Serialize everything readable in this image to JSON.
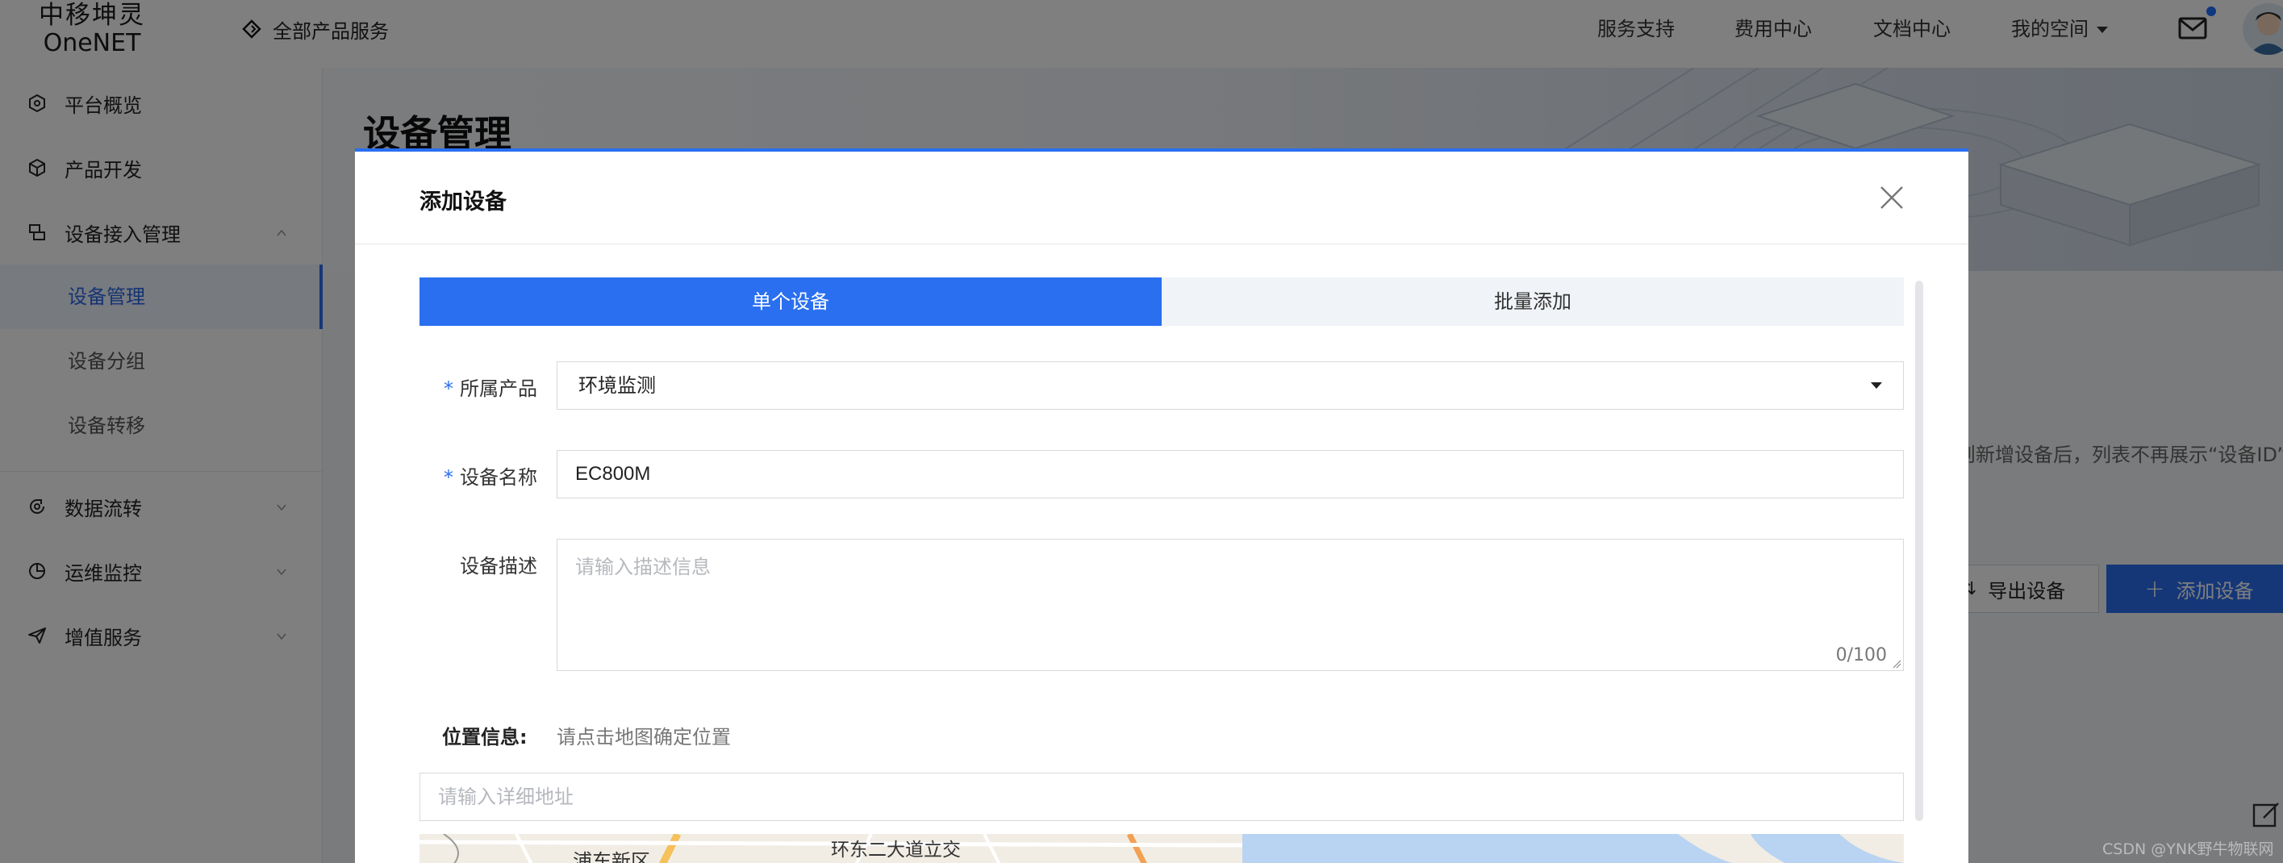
{
  "header": {
    "logo_cn": "中移坤灵",
    "logo_en": "OneNET",
    "all_products": "全部产品服务",
    "nav": [
      "服务支持",
      "费用中心",
      "文档中心",
      "我的空间"
    ]
  },
  "sidebar": {
    "items": [
      {
        "label": "平台概览"
      },
      {
        "label": "产品开发"
      },
      {
        "label": "设备接入管理"
      },
      {
        "label": "设备管理"
      },
      {
        "label": "设备分组"
      },
      {
        "label": "设备转移"
      },
      {
        "label": "数据流转"
      },
      {
        "label": "运维监控"
      },
      {
        "label": "增值服务"
      }
    ]
  },
  "page": {
    "title": "设备管理",
    "notice": "则新增设备后，列表不再展示“设备ID”",
    "export_label": "导出设备",
    "add_label": "添加设备"
  },
  "modal": {
    "title": "添加设备",
    "tabs": [
      {
        "label": "单个设备",
        "active": true
      },
      {
        "label": "批量添加",
        "active": false
      }
    ],
    "form": {
      "product_label": "所属产品",
      "product_value": "环境监测",
      "name_label": "设备名称",
      "name_value": "EC800M",
      "desc_label": "设备描述",
      "desc_placeholder": "请输入描述信息",
      "desc_count": "0/100",
      "location_label": "位置信息:",
      "location_hint": "请点击地图确定位置",
      "address_placeholder": "请输入详细地址",
      "required_mark": "*"
    },
    "map": {
      "labels": [
        "浦东新区",
        "环东二大道立交"
      ]
    }
  },
  "watermark": "CSDN @YNK野牛物联网",
  "colors": {
    "accent": "#2a6ff0",
    "overlay": "rgba(0,0,0,0.5)"
  }
}
